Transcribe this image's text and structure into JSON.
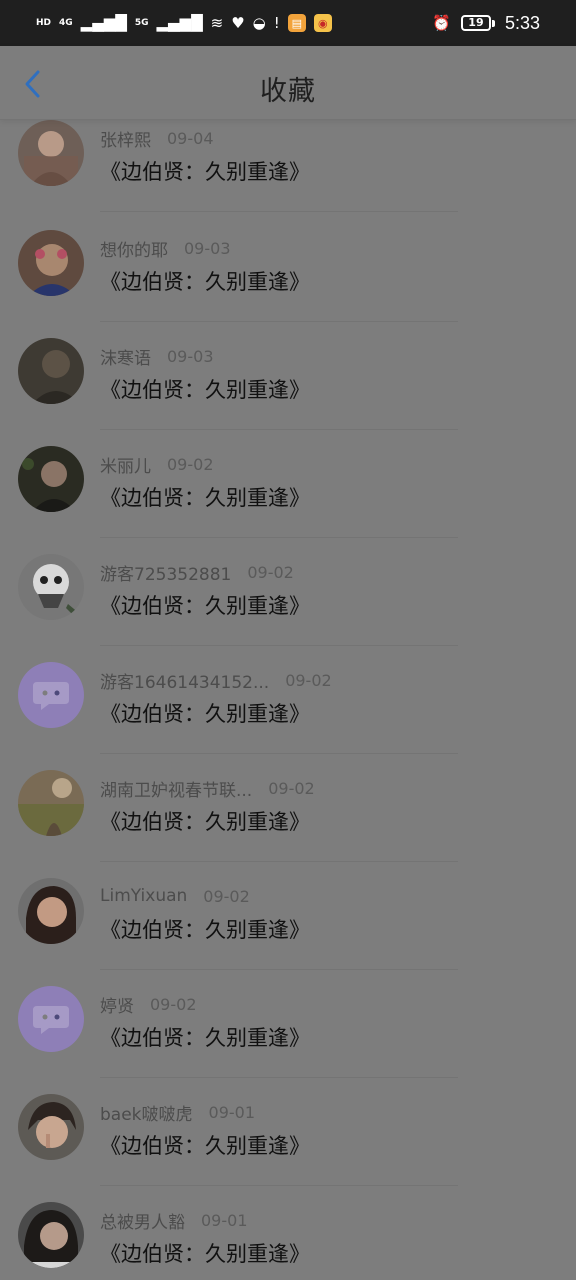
{
  "status_bar": {
    "network1": "4G",
    "network2": "5G",
    "battery": "19",
    "time": "5:33"
  },
  "header": {
    "title": "收藏"
  },
  "items": [
    {
      "name": "张梓熙",
      "date": "09-04",
      "book": "《边伯贤：久别重逢》"
    },
    {
      "name": "想你的耶",
      "date": "09-03",
      "book": "《边伯贤：久别重逢》"
    },
    {
      "name": "沫寒语",
      "date": "09-03",
      "book": "《边伯贤：久别重逢》"
    },
    {
      "name": "米丽儿",
      "date": "09-02",
      "book": "《边伯贤：久别重逢》"
    },
    {
      "name": "游客725352881",
      "date": "09-02",
      "book": "《边伯贤：久别重逢》"
    },
    {
      "name": "游客16461434152...",
      "date": "09-02",
      "book": "《边伯贤：久别重逢》"
    },
    {
      "name": "湖南卫妒视春节联...",
      "date": "09-02",
      "book": "《边伯贤：久别重逢》"
    },
    {
      "name": "LimYixuan",
      "date": "09-02",
      "book": "《边伯贤：久别重逢》"
    },
    {
      "name": "婷贤",
      "date": "09-02",
      "book": "《边伯贤：久别重逢》"
    },
    {
      "name": "baek啵啵虎",
      "date": "09-01",
      "book": "《边伯贤：久别重逢》"
    },
    {
      "name": "总被男人豁",
      "date": "09-01",
      "book": "《边伯贤：久别重逢》"
    }
  ]
}
